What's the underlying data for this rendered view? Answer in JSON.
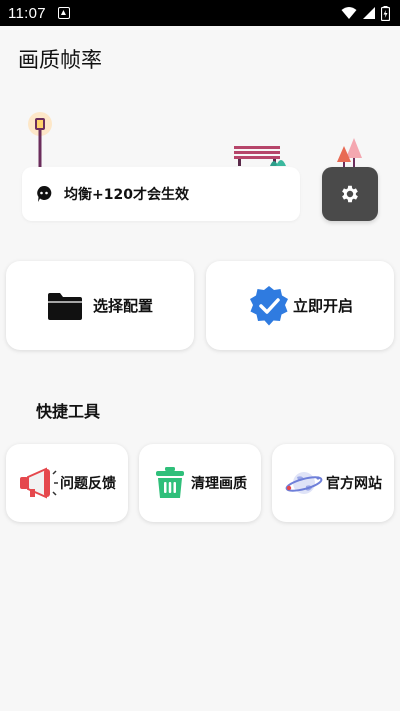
{
  "status_bar": {
    "time": "11:07",
    "icons": [
      "notification-icon",
      "wifi-icon",
      "signal-icon",
      "battery-icon"
    ]
  },
  "page": {
    "title": "画质帧率"
  },
  "banner": {
    "illustration": [
      "street-lamp",
      "park-bench",
      "trees"
    ]
  },
  "info_card": {
    "icon": "message-bubble-icon",
    "text": "均衡+120才会生效"
  },
  "settings_button": {
    "icon": "gear-icon"
  },
  "actions": [
    {
      "label": "选择配置",
      "icon": "folder-icon"
    },
    {
      "label": "立即开启",
      "icon": "verified-badge-icon"
    }
  ],
  "tools_section": {
    "title": "快捷工具",
    "items": [
      {
        "label": "问题反馈",
        "icon": "megaphone-icon"
      },
      {
        "label": "清理画质",
        "icon": "trash-icon"
      },
      {
        "label": "官方网站",
        "icon": "planet-icon"
      }
    ]
  },
  "colors": {
    "background": "#f7f7f7",
    "settings_button": "#4a4a4a",
    "badge_blue": "#2f7be0",
    "trash_green": "#2fbf7a",
    "megaphone_red": "#e5484d"
  }
}
